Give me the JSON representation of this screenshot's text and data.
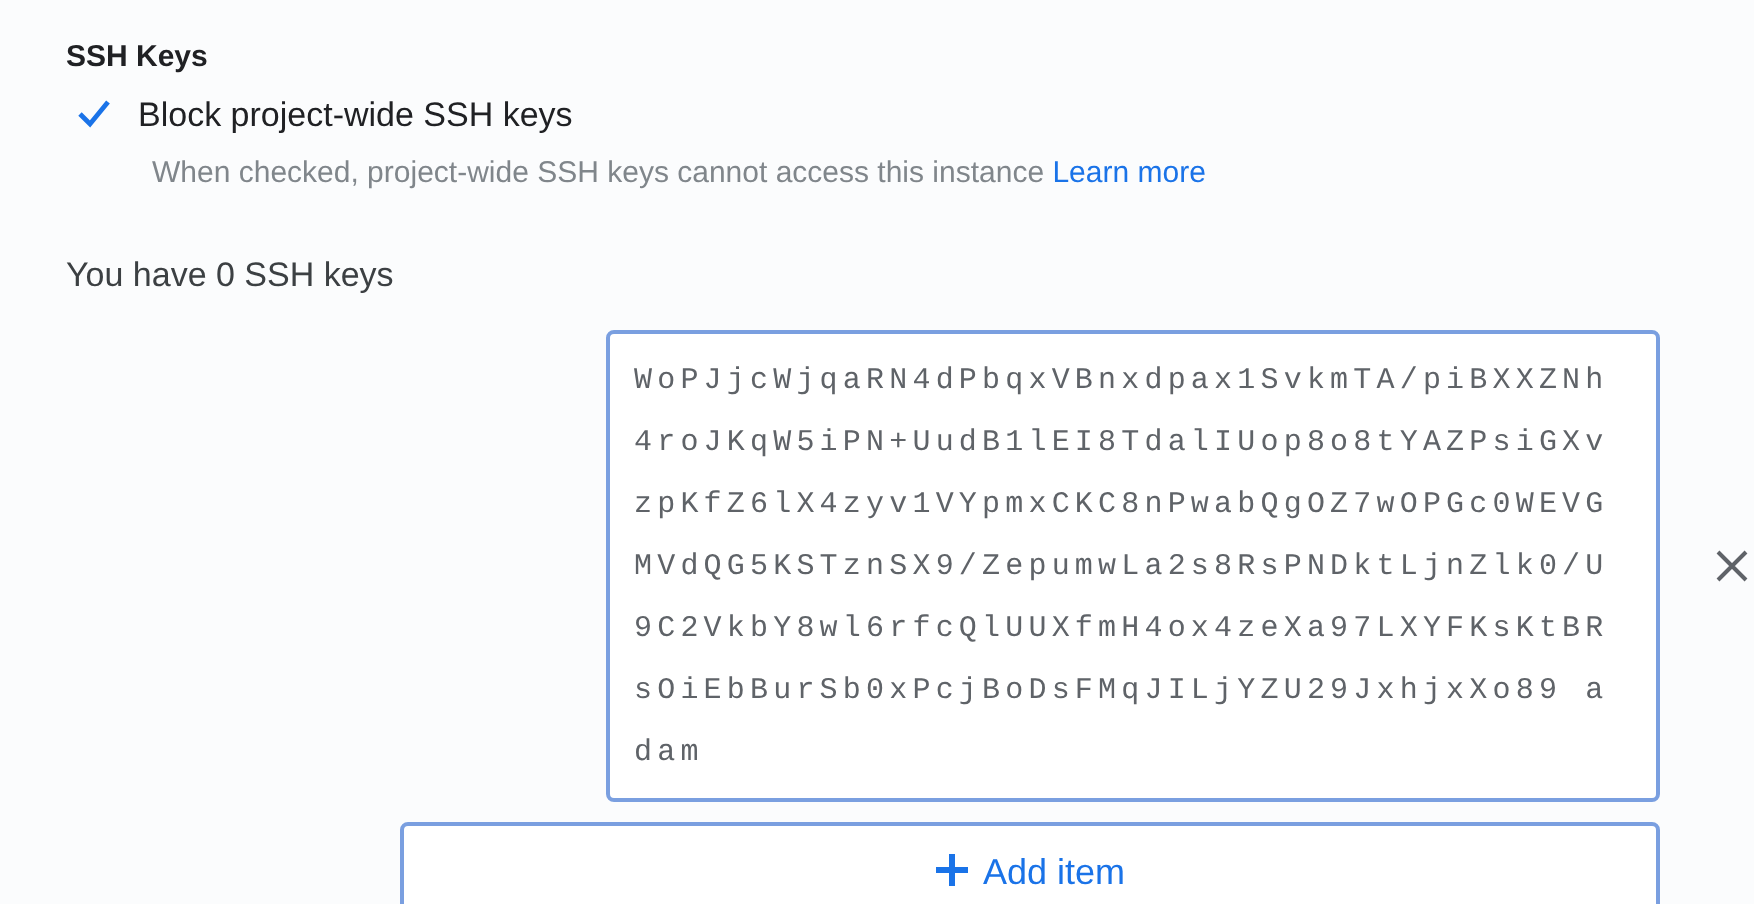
{
  "section_title": "SSH Keys",
  "block_checkbox": {
    "label": "Block project-wide SSH keys",
    "checked": true,
    "help": "When checked, project-wide SSH keys cannot access this instance",
    "link": "Learn more"
  },
  "key_count": "You have 0 SSH keys",
  "key_field": {
    "lines": [
      "WoPJjcWjqaRN4dPbqxVBnxdpax1SvkmTA/piBXXZNh",
      "4roJKqW5iPN+UudB1lEI8TdalIUop8o8tYAZPsiGXv",
      "zpKfZ6lX4zyv1VYpmxCKC8nPwabQgOZ7wOPGc0WEVG",
      "MVdQG5KSTznSX9/ZepumwLa2s8RsPNDktLjnZlk0/U",
      "9C2VkbY8wl6rfcQlUUXfmH4ox4zeXa97LXYFKsKtBR",
      "sOiEbBurSb0xPcjBoDsFMqJILjYZU29JxhjxXo89 a",
      "dam"
    ]
  },
  "add_button": {
    "label": "Add item"
  }
}
